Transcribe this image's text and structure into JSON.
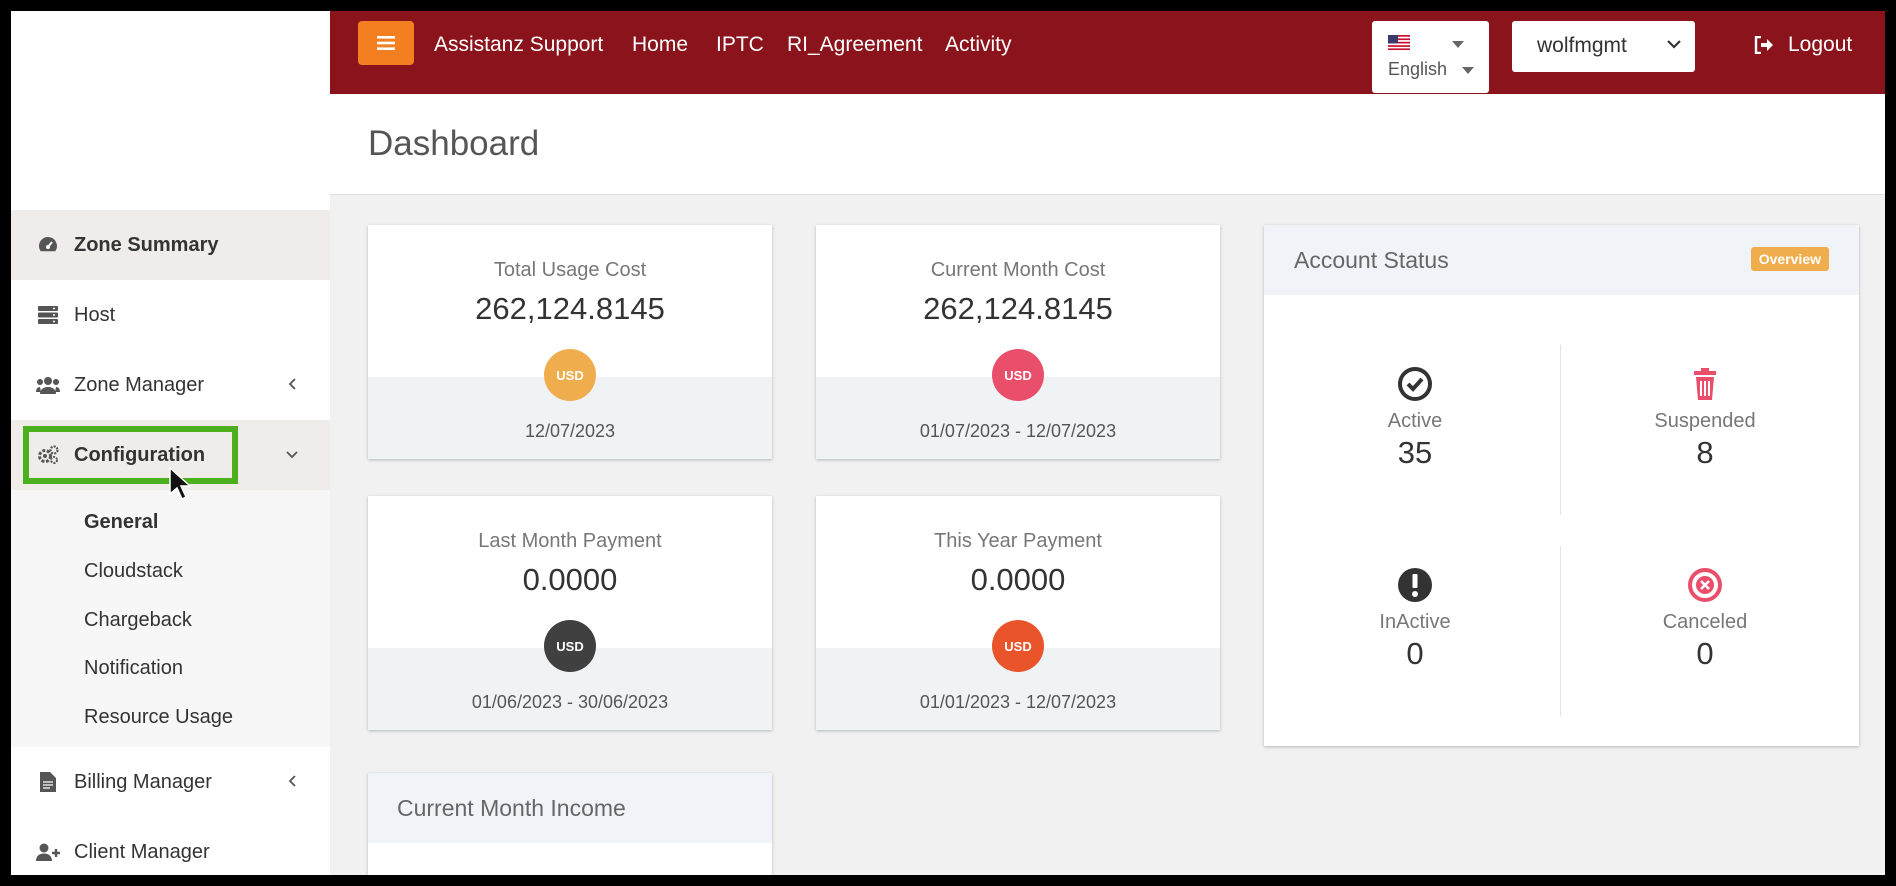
{
  "topbar": {
    "app_name": "Assistanz Support",
    "nav": [
      "Home",
      "IPTC",
      "RI_Agreement",
      "Activity"
    ],
    "language": "English",
    "user": "wolfmgmt",
    "logout": "Logout",
    "bar_color": "#8b141c",
    "menu_button_color": "#f47f20"
  },
  "sidebar": {
    "zone_summary": "Zone Summary",
    "host": "Host",
    "zone_manager": "Zone Manager",
    "configuration": "Configuration",
    "submenu": [
      "General",
      "Cloudstack",
      "Chargeback",
      "Notification",
      "Resource Usage"
    ],
    "billing_manager": "Billing Manager",
    "client_manager": "Client Manager",
    "highlight_color": "#4caf1e"
  },
  "page": {
    "title": "Dashboard"
  },
  "cards": [
    {
      "label": "Total Usage Cost",
      "value": "262,124.8145",
      "currency": "USD",
      "date": "12/07/2023",
      "badge_color": "#f0ad4e"
    },
    {
      "label": "Current Month Cost",
      "value": "262,124.8145",
      "currency": "USD",
      "date": "01/07/2023 - 12/07/2023",
      "badge_color": "#e94e6a"
    },
    {
      "label": "Last Month Payment",
      "value": "0.0000",
      "currency": "USD",
      "date": "01/06/2023 - 30/06/2023",
      "badge_color": "#404040"
    },
    {
      "label": "This Year Payment",
      "value": "0.0000",
      "currency": "USD",
      "date": "01/01/2023 - 12/07/2023",
      "badge_color": "#e9542a"
    }
  ],
  "account_status": {
    "title": "Account Status",
    "badge": "Overview",
    "stats": [
      {
        "label": "Active",
        "value": "35",
        "icon": "check-circle-icon"
      },
      {
        "label": "Suspended",
        "value": "8",
        "icon": "trash-icon"
      },
      {
        "label": "InActive",
        "value": "0",
        "icon": "exclamation-circle-icon"
      },
      {
        "label": "Canceled",
        "value": "0",
        "icon": "times-circle-icon"
      }
    ]
  },
  "income": {
    "title": "Current Month Income"
  }
}
